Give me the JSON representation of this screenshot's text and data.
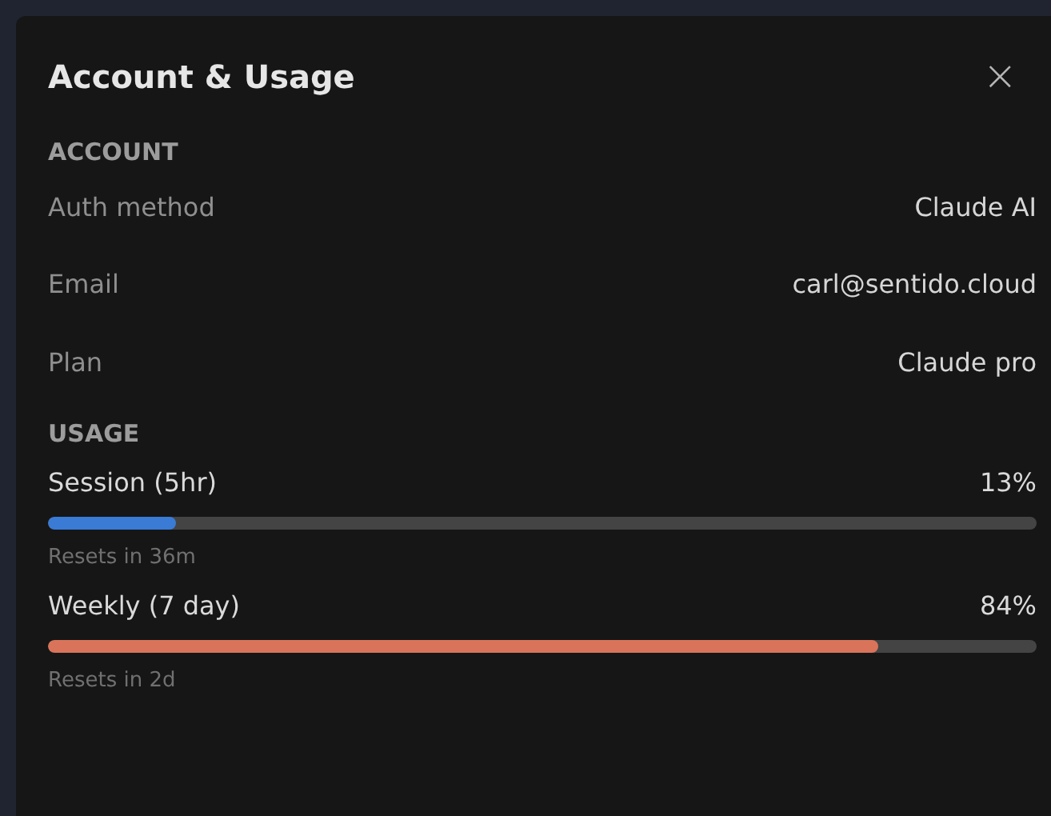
{
  "panel": {
    "title": "Account & Usage",
    "close_label": "×"
  },
  "account": {
    "heading": "ACCOUNT",
    "rows": [
      {
        "label": "Auth method",
        "value": "Claude AI"
      },
      {
        "label": "Email",
        "value": "carl@sentido.cloud"
      },
      {
        "label": "Plan",
        "value": "Claude pro"
      }
    ]
  },
  "usage": {
    "heading": "USAGE",
    "meters": [
      {
        "name": "Session (5hr)",
        "reading": "13%",
        "level": 0.13,
        "color": "#3a7bd5",
        "reset": "Resets in 36m"
      },
      {
        "name": "Weekly (7 day)",
        "reading": "84%",
        "level": 0.84,
        "color": "#d9745a",
        "reset": "Resets in 2d"
      }
    ]
  }
}
